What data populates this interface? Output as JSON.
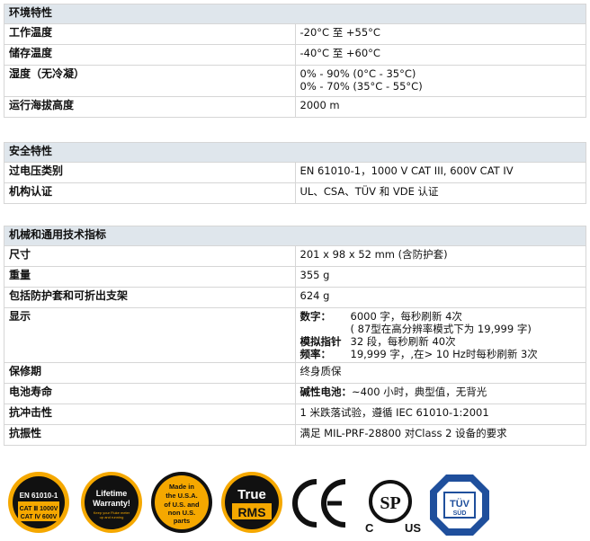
{
  "env": {
    "title": "环境特性",
    "rows": [
      {
        "k": "工作温度",
        "v": "-20°C 至 +55°C"
      },
      {
        "k": "储存温度",
        "v": "-40°C 至 +60°C"
      },
      {
        "k": "湿度（无冷凝）",
        "v1": "0% - 90% (0°C - 35°C)",
        "v2": "0% - 70% (35°C - 55°C)"
      },
      {
        "k": "运行海拔高度",
        "v": "2000 m"
      }
    ]
  },
  "safety": {
    "title": "安全特性",
    "rows": [
      {
        "k": "过电压类别",
        "v": "EN 61010-1，1000 V CAT III, 600V CAT IV"
      },
      {
        "k": "机构认证",
        "v": "UL、CSA、TÜV 和 VDE 认证"
      }
    ]
  },
  "mech": {
    "title": "机械和通用技术指标",
    "size": {
      "k": "尺寸",
      "v": "201 x 98 x 52 mm (含防护套)"
    },
    "weight": {
      "k": "重量",
      "v": "355 g"
    },
    "weight_full": {
      "k": "包括防护套和可折出支架",
      "v": "624 g"
    },
    "display": {
      "k": "显示",
      "digital_label": "数字：",
      "digital_1": "6000 字，每秒刷新 4次",
      "digital_2": "( 87型在高分辨率模式下为 19,999 字)",
      "analog_label": "模拟指针",
      "analog_val": "32 段，每秒刷新 40次",
      "freq_label": "频率：",
      "freq_val": "19,999 字，,在> 10 Hz时每秒刷新 3次"
    },
    "warranty": {
      "k": "保修期",
      "v": "终身质保"
    },
    "battery": {
      "k": "电池寿命",
      "label": "碱性电池：",
      "v": "~400 小时，典型值，无背光"
    },
    "shock": {
      "k": "抗冲击性",
      "v": "1 米跌落试验，遵循 IEC 61010-1:2001"
    },
    "vibration": {
      "k": "抗振性",
      "v": "满足 MIL-PRF-28800 对Class 2 设备的要求"
    }
  },
  "logos": {
    "en": {
      "l1": "EN 61010-1",
      "l2": "CAT Ⅲ 1000V",
      "l3": "CAT Ⅳ 600V"
    },
    "lifetime": {
      "l1": "Lifetime",
      "l2": "Warranty!",
      "l3": "Keep your Fluke meter",
      "l4": "up and running"
    },
    "usa": {
      "l1": "Made in",
      "l2": "the U.S.A.",
      "l3": "of U.S. and",
      "l4": "non U.S.",
      "l5": "parts"
    },
    "rms": {
      "l1": "True",
      "l2": "RMS"
    },
    "ce": "CE",
    "csa": {
      "c": "C",
      "us": "US",
      "sp": "SP"
    },
    "tuv": {
      "l1": "TÜV",
      "l2": "SÜD"
    }
  }
}
